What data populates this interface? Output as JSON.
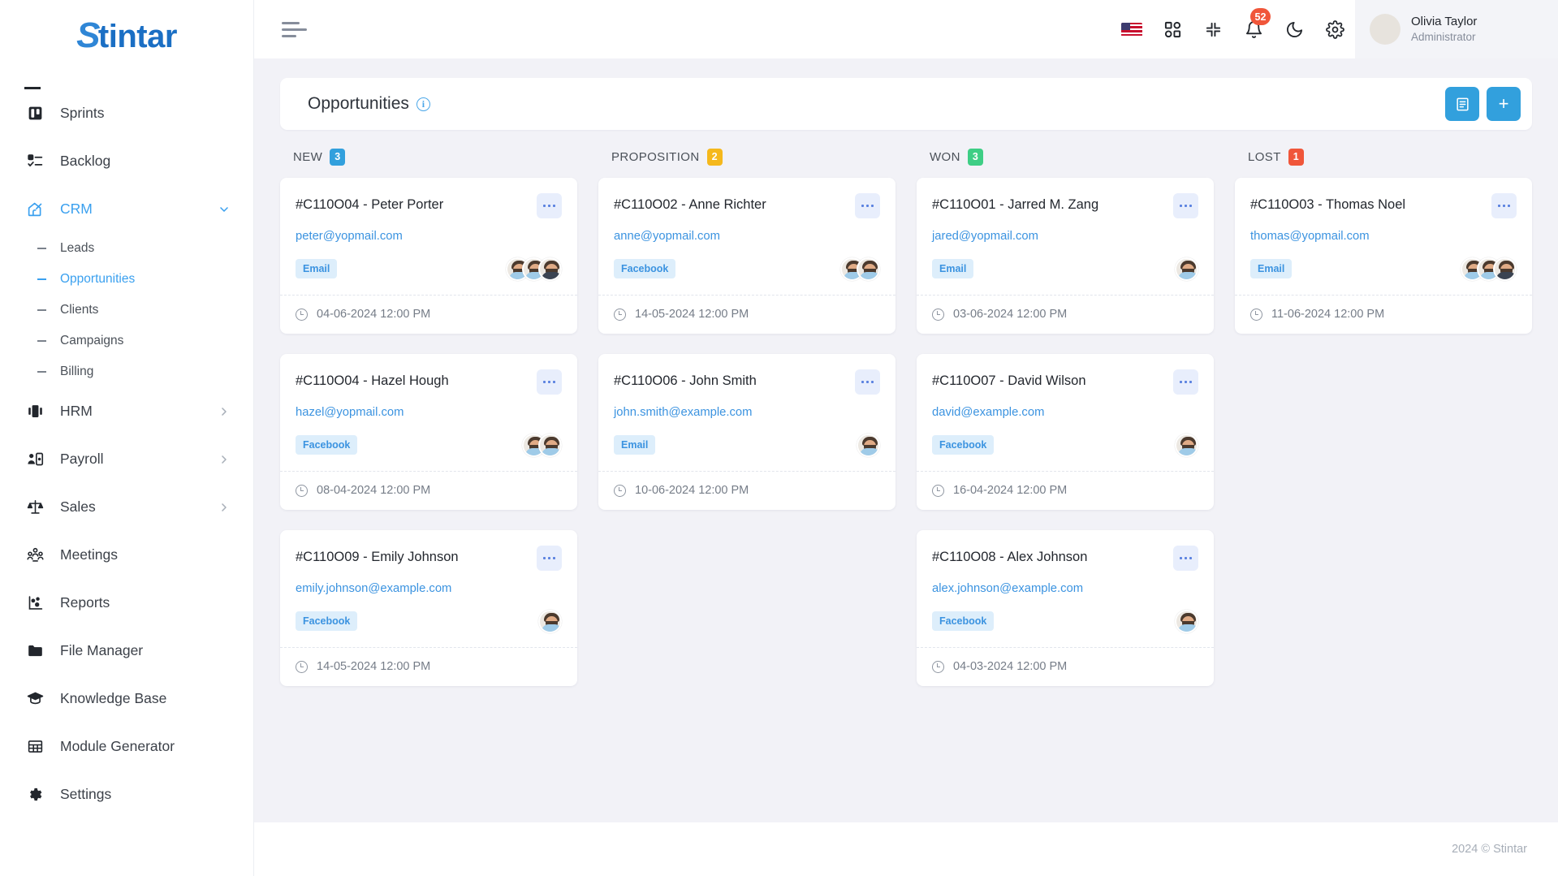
{
  "brand": {
    "name": "Stintar",
    "initial": "S",
    "rest": "tintar"
  },
  "sidebar": {
    "items": [
      {
        "label": "Sprints",
        "icon": "sprints-icon",
        "caret": "",
        "active": false
      },
      {
        "label": "Backlog",
        "icon": "backlog-icon",
        "caret": "",
        "active": false
      },
      {
        "label": "CRM",
        "icon": "crm-icon",
        "caret": "chevron-down-icon",
        "active": true
      },
      {
        "label": "HRM",
        "icon": "hrm-icon",
        "caret": "chevron-right-icon",
        "active": false
      },
      {
        "label": "Payroll",
        "icon": "payroll-icon",
        "caret": "chevron-right-icon",
        "active": false
      },
      {
        "label": "Sales",
        "icon": "sales-icon",
        "caret": "chevron-right-icon",
        "active": false
      },
      {
        "label": "Meetings",
        "icon": "meetings-icon",
        "caret": "",
        "active": false
      },
      {
        "label": "Reports",
        "icon": "reports-icon",
        "caret": "",
        "active": false
      },
      {
        "label": "File Manager",
        "icon": "folder-icon",
        "caret": "",
        "active": false
      },
      {
        "label": "Knowledge Base",
        "icon": "graduation-cap-icon",
        "caret": "",
        "active": false
      },
      {
        "label": "Module Generator",
        "icon": "grid-table-icon",
        "caret": "",
        "active": false
      },
      {
        "label": "Settings",
        "icon": "gear-icon",
        "caret": "",
        "active": false
      }
    ],
    "crm_subitems": [
      {
        "label": "Leads",
        "active": false
      },
      {
        "label": "Opportunities",
        "active": true
      },
      {
        "label": "Clients",
        "active": false
      },
      {
        "label": "Campaigns",
        "active": false
      },
      {
        "label": "Billing",
        "active": false
      }
    ]
  },
  "topbar": {
    "menu_icon": "hamburger-icon",
    "language_flag": "us-flag-icon",
    "apps_icon": "apps-grid-icon",
    "fullscreen_icon": "collapse-fullscreen-icon",
    "notifications_icon": "bell-icon",
    "notifications_count": "52",
    "dark_mode_icon": "moon-icon",
    "settings_icon": "gear-icon",
    "user": {
      "name": "Olivia Taylor",
      "role": "Administrator",
      "avatar": "user-avatar"
    }
  },
  "page": {
    "title": "Opportunities",
    "info_icon": "info-circle-icon",
    "list_view_icon": "list-view-icon",
    "add_label": "+"
  },
  "board": {
    "columns": [
      {
        "name": "NEW",
        "count": "3",
        "color": "#32a0dd",
        "cards": [
          {
            "title": "#C110O04 - Peter Porter",
            "email": "peter@yopmail.com",
            "tag": "Email",
            "date": "04-06-2024 12:00 PM",
            "avatars": 3
          },
          {
            "title": "#C110O04 - Hazel Hough",
            "email": "hazel@yopmail.com",
            "tag": "Facebook",
            "date": "08-04-2024 12:00 PM",
            "avatars": 2
          },
          {
            "title": "#C110O09 - Emily Johnson",
            "email": "emily.johnson@example.com",
            "tag": "Facebook",
            "date": "14-05-2024 12:00 PM",
            "avatars": 1
          }
        ]
      },
      {
        "name": "PROPOSITION",
        "count": "2",
        "color": "#f5b81c",
        "cards": [
          {
            "title": "#C110O02 - Anne Richter",
            "email": "anne@yopmail.com",
            "tag": "Facebook",
            "date": "14-05-2024 12:00 PM",
            "avatars": 2
          },
          {
            "title": "#C110O06 - John Smith",
            "email": "john.smith@example.com",
            "tag": "Email",
            "date": "10-06-2024 12:00 PM",
            "avatars": 1
          }
        ]
      },
      {
        "name": "WON",
        "count": "3",
        "color": "#3ece85",
        "cards": [
          {
            "title": "#C110O01 - Jarred M. Zang",
            "email": "jared@yopmail.com",
            "tag": "Email",
            "date": "03-06-2024 12:00 PM",
            "avatars": 1
          },
          {
            "title": "#C110O07 - David Wilson",
            "email": "david@example.com",
            "tag": "Facebook",
            "date": "16-04-2024 12:00 PM",
            "avatars": 1
          },
          {
            "title": "#C110O08 - Alex Johnson",
            "email": "alex.johnson@example.com",
            "tag": "Facebook",
            "date": "04-03-2024 12:00 PM",
            "avatars": 1
          }
        ]
      },
      {
        "name": "LOST",
        "count": "1",
        "color": "#f0563a",
        "cards": [
          {
            "title": "#C110O03 - Thomas Noel",
            "email": "thomas@yopmail.com",
            "tag": "Email",
            "date": "11-06-2024 12:00 PM",
            "avatars": 3
          }
        ]
      }
    ]
  },
  "footer": {
    "copyright": "2024 © Stintar"
  }
}
